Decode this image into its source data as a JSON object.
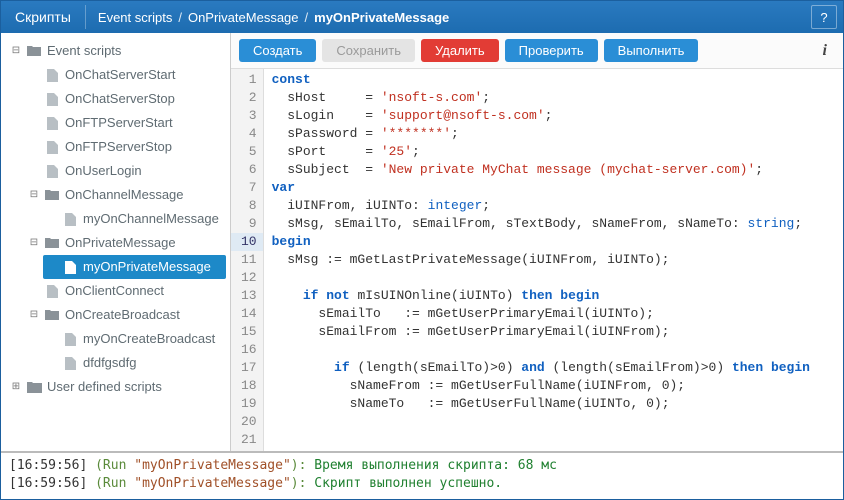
{
  "header": {
    "title": "Скрипты",
    "breadcrumb": [
      "Event scripts",
      "OnPrivateMessage",
      "myOnPrivateMessage"
    ],
    "help": "?"
  },
  "toolbar": {
    "create": "Создать",
    "save": "Сохранить",
    "delete": "Удалить",
    "check": "Проверить",
    "run": "Выполнить"
  },
  "tree": {
    "root": "Event scripts",
    "items": [
      "OnChatServerStart",
      "OnChatServerStop",
      "OnFTPServerStart",
      "OnFTPServerStop",
      "OnUserLogin"
    ],
    "onChannel": {
      "label": "OnChannelMessage",
      "children": [
        "myOnChannelMessage"
      ]
    },
    "onPrivate": {
      "label": "OnPrivateMessage",
      "children": [
        "myOnPrivateMessage"
      ]
    },
    "onClient": "OnClientConnect",
    "onCreateBroadcast": {
      "label": "OnCreateBroadcast",
      "children": [
        "myOnCreateBroadcast",
        "dfdfgsdfg"
      ]
    },
    "userDefined": "User defined scripts"
  },
  "code": {
    "raw": [
      {
        "n": 1,
        "tokens": [
          [
            "kw",
            "const"
          ]
        ]
      },
      {
        "n": 2,
        "tokens": [
          [
            "pl",
            "  sHost     = "
          ],
          [
            "st",
            "'nsoft-s.com'"
          ],
          [
            "pl",
            ";"
          ]
        ]
      },
      {
        "n": 3,
        "tokens": [
          [
            "pl",
            "  sLogin    = "
          ],
          [
            "st",
            "'support@nsoft-s.com'"
          ],
          [
            "pl",
            ";"
          ]
        ]
      },
      {
        "n": 4,
        "tokens": [
          [
            "pl",
            "  sPassword = "
          ],
          [
            "st",
            "'*******'"
          ],
          [
            "pl",
            ";"
          ]
        ]
      },
      {
        "n": 5,
        "tokens": [
          [
            "pl",
            "  sPort     = "
          ],
          [
            "st",
            "'25'"
          ],
          [
            "pl",
            ";"
          ]
        ]
      },
      {
        "n": 6,
        "tokens": [
          [
            "pl",
            "  sSubject  = "
          ],
          [
            "st",
            "'New private MyChat message (mychat-server.com)'"
          ],
          [
            "pl",
            ";"
          ]
        ]
      },
      {
        "n": 7,
        "tokens": [
          [
            "kw",
            "var"
          ]
        ]
      },
      {
        "n": 8,
        "tokens": [
          [
            "pl",
            "  iUINFrom, iUINTo: "
          ],
          [
            "ty",
            "integer"
          ],
          [
            "pl",
            ";"
          ]
        ]
      },
      {
        "n": 9,
        "tokens": [
          [
            "pl",
            "  sMsg, sEmailTo, sEmailFrom, sTextBody, sNameFrom, sNameTo: "
          ],
          [
            "ty",
            "string"
          ],
          [
            "pl",
            ";"
          ]
        ]
      },
      {
        "n": 10,
        "hl": true,
        "tokens": [
          [
            "kw",
            "begin"
          ]
        ]
      },
      {
        "n": 11,
        "tokens": [
          [
            "pl",
            "  sMsg := mGetLastPrivateMessage(iUINFrom, iUINTo);"
          ]
        ]
      },
      {
        "n": 12,
        "tokens": [
          [
            "pl",
            " "
          ]
        ]
      },
      {
        "n": 13,
        "tokens": [
          [
            "pl",
            "    "
          ],
          [
            "kw",
            "if not"
          ],
          [
            "pl",
            " mIsUINOnline(iUINTo) "
          ],
          [
            "kw",
            "then begin"
          ]
        ]
      },
      {
        "n": 14,
        "tokens": [
          [
            "pl",
            "      sEmailTo   := mGetUserPrimaryEmail(iUINTo);"
          ]
        ]
      },
      {
        "n": 15,
        "tokens": [
          [
            "pl",
            "      sEmailFrom := mGetUserPrimaryEmail(iUINFrom);"
          ]
        ]
      },
      {
        "n": 16,
        "tokens": [
          [
            "pl",
            " "
          ]
        ]
      },
      {
        "n": 17,
        "tokens": [
          [
            "pl",
            "        "
          ],
          [
            "kw",
            "if"
          ],
          [
            "pl",
            " (length(sEmailTo)>"
          ],
          [
            "num",
            "0"
          ],
          [
            "pl",
            ") "
          ],
          [
            "kw",
            "and"
          ],
          [
            "pl",
            " (length(sEmailFrom)>"
          ],
          [
            "num",
            "0"
          ],
          [
            "pl",
            ") "
          ],
          [
            "kw",
            "then begin"
          ]
        ]
      },
      {
        "n": 18,
        "tokens": [
          [
            "pl",
            "          sNameFrom := mGetUserFullName(iUINFrom, "
          ],
          [
            "num",
            "0"
          ],
          [
            "pl",
            ");"
          ]
        ]
      },
      {
        "n": 19,
        "tokens": [
          [
            "pl",
            "          sNameTo   := mGetUserFullName(iUINTo, "
          ],
          [
            "num",
            "0"
          ],
          [
            "pl",
            ");"
          ]
        ]
      },
      {
        "n": 20,
        "tokens": [
          [
            "pl",
            " "
          ]
        ]
      },
      {
        "n": 21,
        "tokens": [
          [
            "pl",
            " "
          ]
        ]
      }
    ]
  },
  "console": {
    "lines": [
      {
        "ts": "[16:59:56]",
        "run": " (Run ",
        "rq": "\"myOnPrivateMessage\"",
        "rp": "): ",
        "msg": "Время выполнения скрипта: 68 мс"
      },
      {
        "ts": "[16:59:56]",
        "run": " (Run ",
        "rq": "\"myOnPrivateMessage\"",
        "rp": "): ",
        "msg": "Скрипт выполнен успешно."
      }
    ]
  }
}
